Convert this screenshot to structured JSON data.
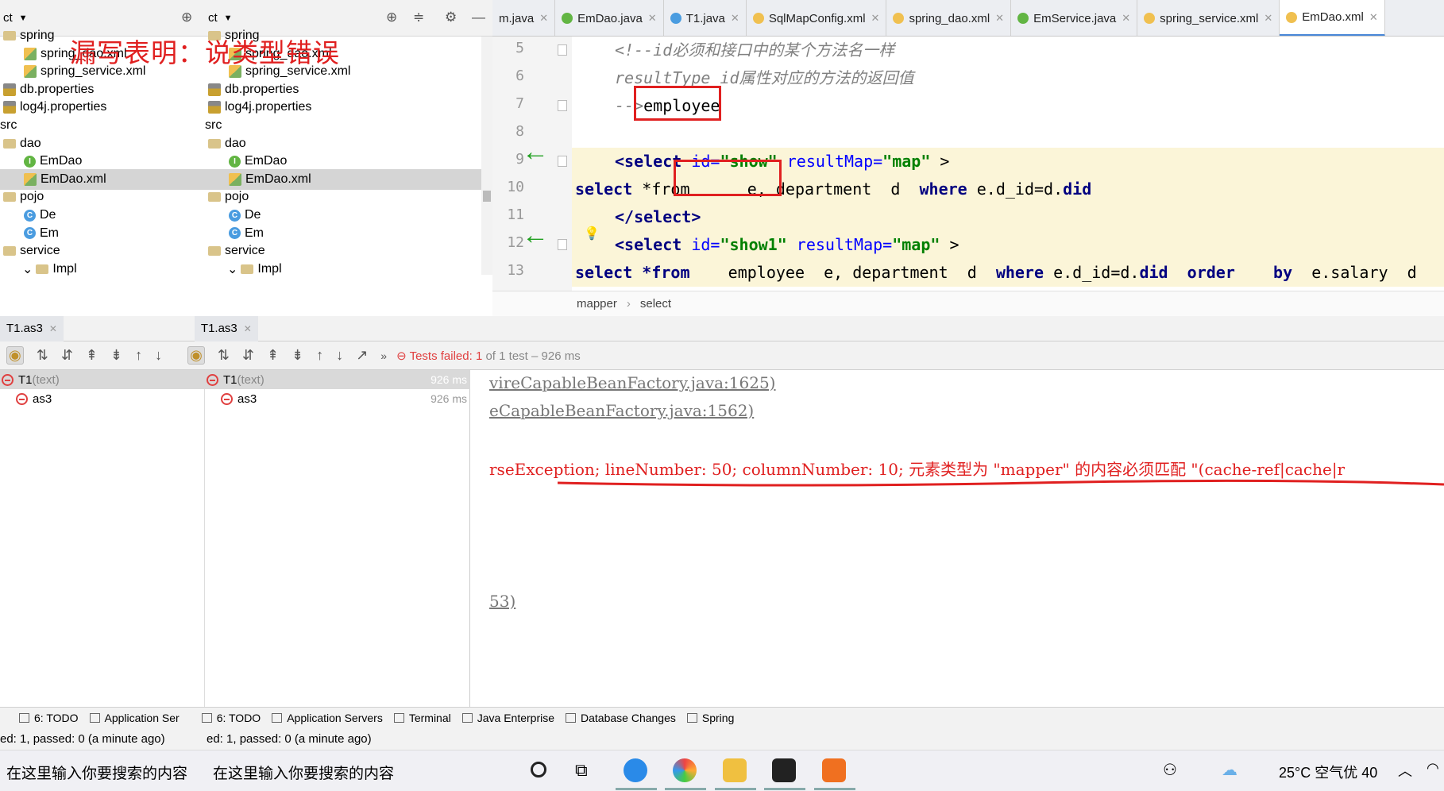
{
  "left_panels": [
    {
      "title": "ct",
      "tree": [
        {
          "label": "spring",
          "icon": "folder-icon"
        },
        {
          "label": "spring_dao.xml",
          "icon": "xml-file-icon"
        },
        {
          "label": "spring_service.xml",
          "icon": "xml-file-icon"
        },
        {
          "label": "db.properties",
          "icon": "properties-file-icon"
        },
        {
          "label": "log4j.properties",
          "icon": "properties-file-icon"
        },
        {
          "label": "src",
          "icon": ""
        },
        {
          "label": "dao",
          "icon": "folder-icon"
        },
        {
          "label": "EmDao",
          "icon": "interface-icon"
        },
        {
          "label": "EmDao.xml",
          "icon": "xml-file-icon"
        },
        {
          "label": "pojo",
          "icon": "folder-icon"
        },
        {
          "label": "De",
          "icon": "class-icon"
        },
        {
          "label": "Em",
          "icon": "class-icon"
        },
        {
          "label": "service",
          "icon": "folder-icon"
        },
        {
          "label": "Impl",
          "icon": "folder-icon"
        }
      ]
    },
    {
      "title": "ct",
      "tree": [
        {
          "label": "spring",
          "icon": "folder-icon"
        },
        {
          "label": "spring_dao.xml",
          "icon": "xml-file-icon"
        },
        {
          "label": "spring_service.xml",
          "icon": "xml-file-icon"
        },
        {
          "label": "db.properties",
          "icon": "properties-file-icon"
        },
        {
          "label": "log4j.properties",
          "icon": "properties-file-icon"
        },
        {
          "label": "src",
          "icon": ""
        },
        {
          "label": "dao",
          "icon": "folder-icon"
        },
        {
          "label": "EmDao",
          "icon": "interface-icon"
        },
        {
          "label": "EmDao.xml",
          "icon": "xml-file-icon"
        },
        {
          "label": "pojo",
          "icon": "folder-icon"
        },
        {
          "label": "De",
          "icon": "class-icon"
        },
        {
          "label": "Em",
          "icon": "class-icon"
        },
        {
          "label": "service",
          "icon": "folder-icon"
        },
        {
          "label": "Impl",
          "icon": "folder-icon"
        }
      ]
    }
  ],
  "annotation": "漏写表明：说类型错误",
  "editor_tabs": [
    {
      "label": "m.java",
      "active": false
    },
    {
      "label": "EmDao.java",
      "active": false
    },
    {
      "label": "T1.java",
      "active": false
    },
    {
      "label": "SqlMapConfig.xml",
      "active": false
    },
    {
      "label": "spring_dao.xml",
      "active": false
    },
    {
      "label": "EmService.java",
      "active": false
    },
    {
      "label": "spring_service.xml",
      "active": false
    },
    {
      "label": "EmDao.xml",
      "active": true
    }
  ],
  "code": {
    "line_numbers": [
      "5",
      "6",
      "7",
      "8",
      "9",
      "10",
      "11",
      "12",
      "13"
    ],
    "line5": "<!--id必须和接口中的某个方法名一样",
    "line6": "resultType id属性对应的方法的返回值",
    "line7_comment": "--",
    "line7_text": "employee",
    "line9": [
      "<select ",
      "id=",
      "\"show\"",
      " resultMap=",
      "\"map\"",
      " >"
    ],
    "line10": [
      "select",
      " *from      e, department  d  ",
      "where",
      " e.d_id=d.",
      "did"
    ],
    "line11": "</select>",
    "line12": [
      "<select ",
      "id=",
      "\"show1\"",
      " resultMap=",
      "\"map\"",
      " >"
    ],
    "line13": [
      "select",
      " *from",
      "    employee  e, department  d  ",
      "where",
      " e.d_id=d.",
      "did",
      "  order    by  ",
      "e.salary",
      "  d"
    ]
  },
  "breadcrumb": [
    "mapper",
    "select"
  ],
  "run_tabs": [
    {
      "label": "T1.as3"
    },
    {
      "label": "T1.as3"
    }
  ],
  "test_status": {
    "failed_label": "Tests failed:",
    "count": "1",
    "detail": "of 1 test – 926 ms"
  },
  "test_tree": [
    [
      {
        "label": "T1",
        "suffix": " (text)",
        "ms": "926 ms"
      },
      {
        "label": "as3",
        "suffix": "",
        "ms": "926 ms"
      }
    ],
    [
      {
        "label": "T1",
        "suffix": " (text)",
        "ms": "926 ms"
      },
      {
        "label": "as3",
        "suffix": "",
        "ms": "926 ms"
      }
    ]
  ],
  "console": {
    "line1": "vireCapableBeanFactory.java:1625)",
    "line2": "eCapableBeanFactory.java:1562)",
    "line3": "rseException; lineNumber: 50; columnNumber: 10; 元素类型为 \"mapper\" 的内容必须匹配 \"(cache-ref|cache|r",
    "line4": "53)"
  },
  "bottom_tabs": [
    "6: TODO",
    "Application Ser",
    "6: TODO",
    "Application Servers",
    "Terminal",
    "Java Enterprise",
    "Database Changes",
    "Spring"
  ],
  "status_text": [
    "ed: 1, passed: 0 (a minute ago)",
    "ed: 1, passed: 0 (a minute ago)"
  ],
  "taskbar": {
    "search_placeholder": [
      "在这里输入你要搜索的内容",
      "在这里输入你要搜索的内容"
    ],
    "weather": "25°C 空气优 40",
    "accent": "#e02020"
  }
}
